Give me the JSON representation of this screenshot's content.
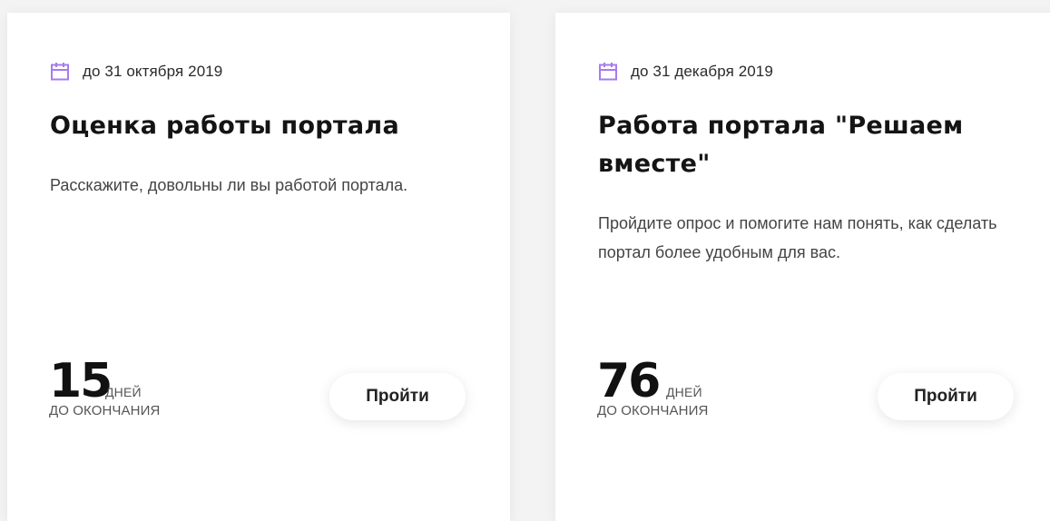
{
  "accent_color": "#a77bf0",
  "cards": [
    {
      "icon": "calendar-icon",
      "deadline": "до 31 октября 2019",
      "title": "Оценка работы портала",
      "description": "Расскажите, довольны ли вы работой портала.",
      "days_left": "15",
      "days_unit": "ДНЕЙ",
      "days_caption": "ДО ОКОНЧАНИЯ",
      "button_label": "Пройти"
    },
    {
      "icon": "calendar-icon",
      "deadline": "до 31 декабря 2019",
      "title": "Работа портала \"Решаем вместе\"",
      "description": "Пройдите опрос и помогите нам понять, как сделать портал более удобным для вас.",
      "days_left": "76",
      "days_unit": "ДНЕЙ",
      "days_caption": "ДО ОКОНЧАНИЯ",
      "button_label": "Пройти"
    }
  ]
}
